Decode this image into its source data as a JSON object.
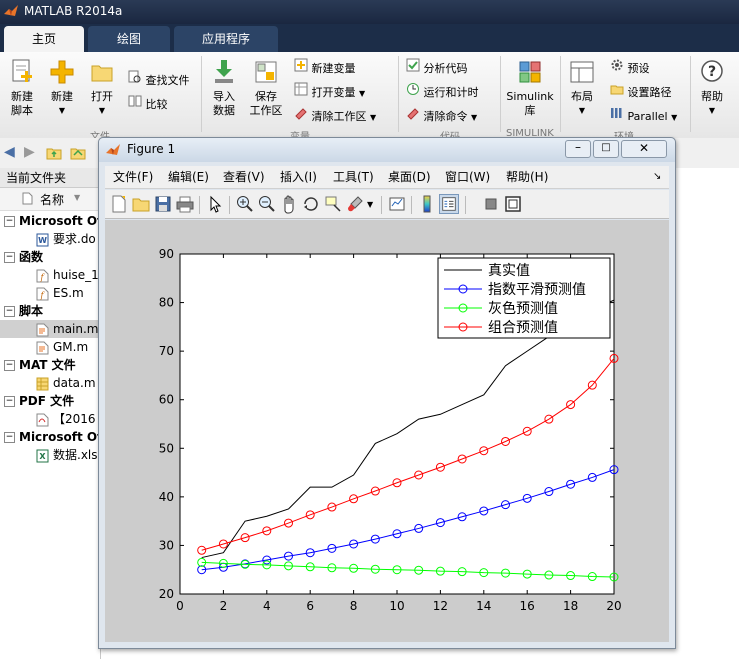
{
  "app": {
    "title": "MATLAB R2014a"
  },
  "ribbon_tabs": [
    {
      "label": "主页",
      "active": true
    },
    {
      "label": "绘图",
      "active": false
    },
    {
      "label": "应用程序",
      "active": false
    }
  ],
  "ribbon": {
    "new_script": "新建\n脚本",
    "new": "新建",
    "open": "打开",
    "find_files": "查找文件",
    "compare": "比较",
    "import_data": "导入\n数据",
    "save_workspace": "保存\n工作区",
    "new_variable": "新建变量",
    "open_variable": "打开变量",
    "clear_workspace": "清除工作区",
    "analyze_code": "分析代码",
    "run_and_time": "运行和计时",
    "clear_commands": "清除命令",
    "simulink": "Simulink\n库",
    "layout": "布局",
    "preferences": "预设",
    "set_path": "设置路径",
    "parallel": "Parallel",
    "help": "帮助",
    "group_file": "文件",
    "group_variable": "变量",
    "group_code": "代码",
    "group_simulink": "SIMULINK",
    "group_env": "环境"
  },
  "current_folder": {
    "header": "当前文件夹",
    "col_name": "名称",
    "rows": [
      {
        "label": "Microsoft Of",
        "type": "group"
      },
      {
        "label": "要求.do",
        "type": "file",
        "icon": "word-icon"
      },
      {
        "label": "函数",
        "type": "group"
      },
      {
        "label": "huise_1",
        "type": "file",
        "icon": "function-icon"
      },
      {
        "label": "ES.m",
        "type": "file",
        "icon": "function-icon"
      },
      {
        "label": "脚本",
        "type": "group"
      },
      {
        "label": "main.m",
        "type": "file",
        "icon": "script-icon",
        "selected": true
      },
      {
        "label": "GM.m",
        "type": "file",
        "icon": "script-icon"
      },
      {
        "label": "MAT 文件",
        "type": "group"
      },
      {
        "label": "data.m",
        "type": "file",
        "icon": "mat-icon"
      },
      {
        "label": "PDF 文件",
        "type": "group"
      },
      {
        "label": "【2016",
        "type": "file",
        "icon": "pdf-icon"
      },
      {
        "label": "Microsoft Of",
        "type": "group"
      },
      {
        "label": "数据.xls",
        "type": "file",
        "icon": "excel-icon"
      }
    ]
  },
  "figure": {
    "title": "Figure 1",
    "menu": [
      "文件(F)",
      "编辑(E)",
      "查看(V)",
      "插入(I)",
      "工具(T)",
      "桌面(D)",
      "窗口(W)",
      "帮助(H)"
    ]
  },
  "chart_data": {
    "type": "line",
    "title": "",
    "xlabel": "",
    "ylabel": "",
    "xlim": [
      0,
      20
    ],
    "ylim": [
      20,
      90
    ],
    "xticks": [
      0,
      2,
      4,
      6,
      8,
      10,
      12,
      14,
      16,
      18,
      20
    ],
    "yticks": [
      20,
      30,
      40,
      50,
      60,
      70,
      80,
      90
    ],
    "grid": false,
    "legend_position": "top-right",
    "x": [
      1,
      2,
      3,
      4,
      5,
      6,
      7,
      8,
      9,
      10,
      11,
      12,
      13,
      14,
      15,
      16,
      17,
      18,
      19,
      20
    ],
    "series": [
      {
        "name": "真实值",
        "color": "#000000",
        "marker": "none",
        "values": [
          27.5,
          28.5,
          35.0,
          36.0,
          37.5,
          42.0,
          42.0,
          44.5,
          51.0,
          53.0,
          56.0,
          57.0,
          59.0,
          61.0,
          67.0,
          70.0,
          73.0,
          76.0,
          78.5,
          80.5
        ]
      },
      {
        "name": "指数平滑预测值",
        "color": "#0000ff",
        "marker": "circle",
        "values": [
          25.0,
          25.5,
          26.2,
          27.0,
          27.8,
          28.5,
          29.4,
          30.3,
          31.3,
          32.4,
          33.5,
          34.7,
          35.9,
          37.1,
          38.4,
          39.7,
          41.1,
          42.6,
          44.0,
          45.6
        ]
      },
      {
        "name": "灰色预测值",
        "color": "#00ff00",
        "marker": "circle",
        "values": [
          26.5,
          26.3,
          26.1,
          26.0,
          25.8,
          25.6,
          25.4,
          25.3,
          25.1,
          25.0,
          24.9,
          24.7,
          24.6,
          24.4,
          24.3,
          24.1,
          23.9,
          23.8,
          23.6,
          23.5
        ]
      },
      {
        "name": "组合预测值",
        "color": "#ff0000",
        "marker": "circle",
        "values": [
          29.0,
          30.3,
          31.6,
          33.0,
          34.6,
          36.3,
          37.9,
          39.6,
          41.2,
          42.9,
          44.5,
          46.1,
          47.8,
          49.5,
          51.4,
          53.5,
          56.0,
          59.0,
          63.0,
          68.5
        ]
      }
    ]
  }
}
